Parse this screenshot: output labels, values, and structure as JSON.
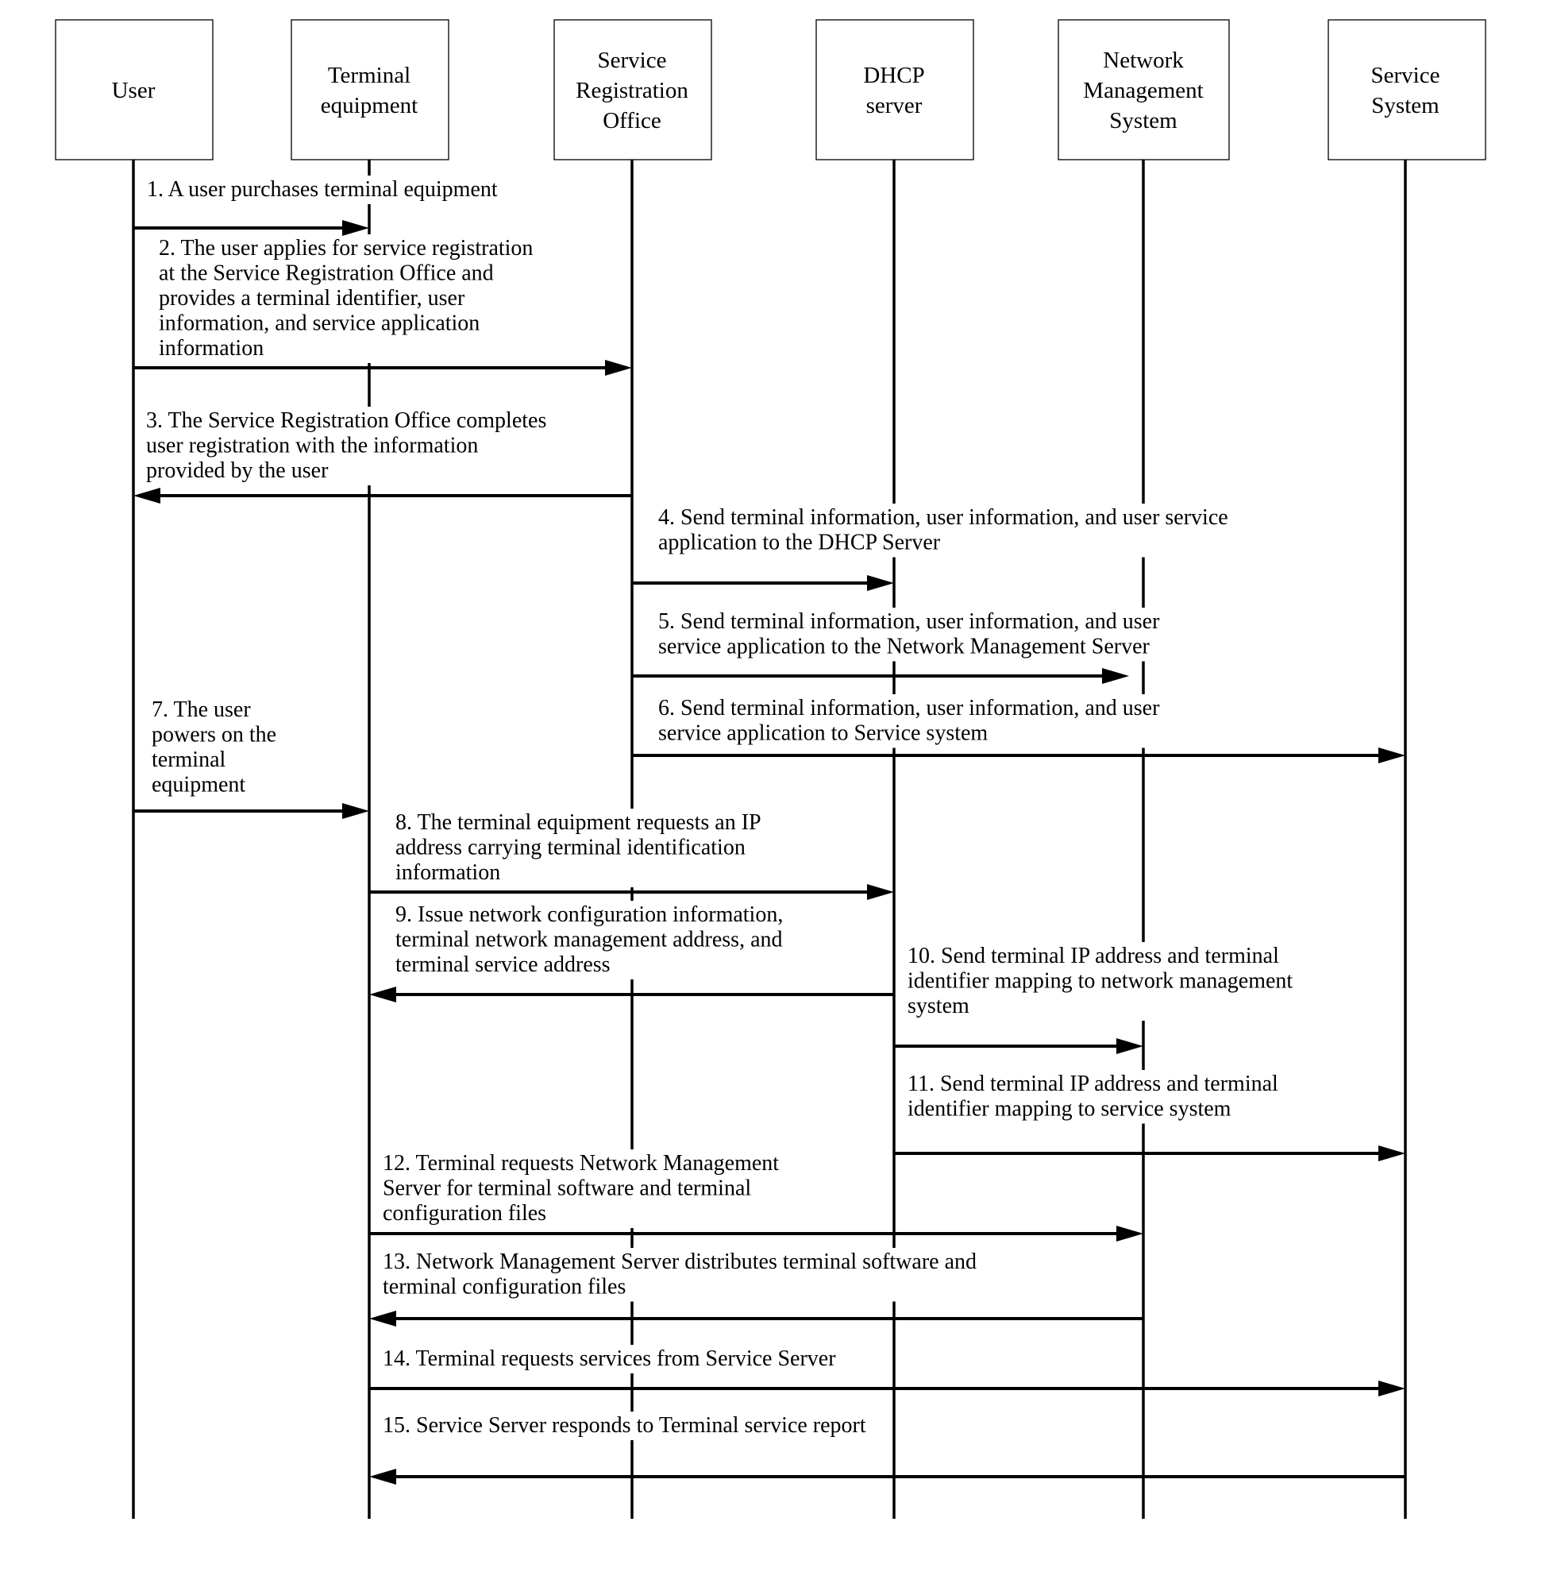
{
  "diagram": {
    "type": "sequence",
    "participants": [
      {
        "id": "user",
        "lines": [
          "User"
        ]
      },
      {
        "id": "terminal",
        "lines": [
          "Terminal",
          "equipment"
        ]
      },
      {
        "id": "sro",
        "lines": [
          "Service",
          "Registration",
          "Office"
        ]
      },
      {
        "id": "dhcp",
        "lines": [
          "DHCP",
          "server"
        ]
      },
      {
        "id": "nms",
        "lines": [
          "Network",
          "Management",
          "System"
        ]
      },
      {
        "id": "ss",
        "lines": [
          "Service",
          "System"
        ]
      }
    ],
    "messages": [
      {
        "step": 1,
        "from": "user",
        "to": "terminal",
        "lines": [
          "1.  A user purchases terminal equipment"
        ]
      },
      {
        "step": 2,
        "from": "user",
        "to": "sro",
        "lines": [
          "2.  The user applies for service registration",
          "at the Service Registration Office and",
          "provides a terminal identifier, user",
          "information, and service application",
          "information"
        ]
      },
      {
        "step": 3,
        "from": "sro",
        "to": "user",
        "lines": [
          "3.  The Service Registration Office completes",
          "user registration with the information",
          "provided by the user"
        ]
      },
      {
        "step": 4,
        "from": "sro",
        "to": "dhcp",
        "lines": [
          "4.  Send terminal information, user information, and user service",
          "application to the DHCP Server"
        ]
      },
      {
        "step": 5,
        "from": "sro",
        "to": "nms",
        "lines": [
          "5.  Send terminal information, user information, and user",
          "service application to the Network Management Server"
        ]
      },
      {
        "step": 6,
        "from": "sro",
        "to": "ss",
        "lines": [
          "6.  Send terminal information, user information, and user",
          "service application to Service system"
        ]
      },
      {
        "step": 7,
        "from": "user",
        "to": "terminal",
        "lines": [
          "7.  The user",
          "powers on the",
          "terminal",
          "equipment"
        ]
      },
      {
        "step": 8,
        "from": "terminal",
        "to": "dhcp",
        "lines": [
          "8.  The terminal equipment requests an IP",
          "address carrying terminal identification",
          "information"
        ]
      },
      {
        "step": 9,
        "from": "dhcp",
        "to": "terminal",
        "lines": [
          "9.  Issue network configuration information,",
          "terminal network management address, and",
          "terminal service address"
        ]
      },
      {
        "step": 10,
        "from": "dhcp",
        "to": "nms",
        "lines": [
          "10. Send terminal IP address and terminal",
          "identifier mapping to network management",
          "system"
        ]
      },
      {
        "step": 11,
        "from": "dhcp",
        "to": "ss",
        "lines": [
          "11. Send terminal IP address and terminal",
          "identifier mapping to service system"
        ]
      },
      {
        "step": 12,
        "from": "terminal",
        "to": "nms",
        "lines": [
          "12.  Terminal requests Network Management",
          "Server for terminal software and terminal",
          "configuration files"
        ]
      },
      {
        "step": 13,
        "from": "nms",
        "to": "terminal",
        "lines": [
          "13.  Network Management Server distributes terminal software and",
          "terminal configuration files"
        ]
      },
      {
        "step": 14,
        "from": "terminal",
        "to": "ss",
        "lines": [
          "14.  Terminal requests services from Service Server"
        ]
      },
      {
        "step": 15,
        "from": "ss",
        "to": "terminal",
        "lines": [
          "15.  Service Server responds to Terminal service report"
        ]
      }
    ]
  }
}
